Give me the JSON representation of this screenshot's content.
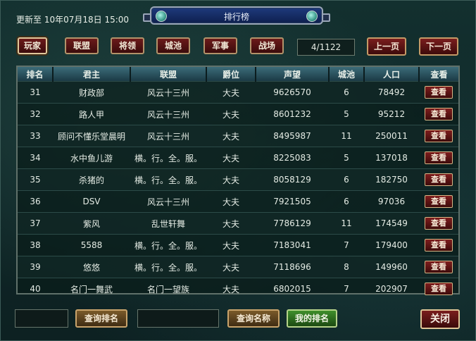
{
  "header": {
    "update_text": "更新至 10年07月18日 15:00",
    "title": "排行榜"
  },
  "tabs": [
    {
      "label": "玩家",
      "active": true
    },
    {
      "label": "联盟",
      "active": false
    },
    {
      "label": "将领",
      "active": false
    },
    {
      "label": "城池",
      "active": false
    },
    {
      "label": "军事",
      "active": false
    },
    {
      "label": "战场",
      "active": false
    }
  ],
  "pagination": {
    "indicator": "4/1122",
    "prev_label": "上一页",
    "next_label": "下一页"
  },
  "table": {
    "columns": [
      "排名",
      "君主",
      "联盟",
      "爵位",
      "声望",
      "城池",
      "人口",
      "查看"
    ],
    "view_label": "查看",
    "rows": [
      {
        "rank": "31",
        "lord": "财政部",
        "alliance": "风云十三州",
        "title": "大夫",
        "prestige": "9626570",
        "cities": "6",
        "population": "78492"
      },
      {
        "rank": "32",
        "lord": "路人甲",
        "alliance": "风云十三州",
        "title": "大夫",
        "prestige": "8601232",
        "cities": "5",
        "population": "95212"
      },
      {
        "rank": "33",
        "lord": "顾问不懂乐堂晨明",
        "alliance": "风云十三州",
        "title": "大夫",
        "prestige": "8495987",
        "cities": "11",
        "population": "250011"
      },
      {
        "rank": "34",
        "lord": "水中鱼儿游",
        "alliance": "横。行。全。服。",
        "title": "大夫",
        "prestige": "8225083",
        "cities": "5",
        "population": "137018"
      },
      {
        "rank": "35",
        "lord": "杀猪的",
        "alliance": "横。行。全。服。",
        "title": "大夫",
        "prestige": "8058129",
        "cities": "6",
        "population": "182750"
      },
      {
        "rank": "36",
        "lord": "DSV",
        "alliance": "风云十三州",
        "title": "大夫",
        "prestige": "7921505",
        "cities": "6",
        "population": "97036"
      },
      {
        "rank": "37",
        "lord": "紫风",
        "alliance": "乱世轩舞",
        "title": "大夫",
        "prestige": "7786129",
        "cities": "11",
        "population": "174549"
      },
      {
        "rank": "38",
        "lord": "5588",
        "alliance": "横。行。全。服。",
        "title": "大夫",
        "prestige": "7183041",
        "cities": "7",
        "population": "179400"
      },
      {
        "rank": "39",
        "lord": "悠悠",
        "alliance": "横。行。全。服。",
        "title": "大夫",
        "prestige": "7118696",
        "cities": "8",
        "population": "149960"
      },
      {
        "rank": "40",
        "lord": "名门一舞武",
        "alliance": "名门一望族",
        "title": "大夫",
        "prestige": "6802015",
        "cities": "7",
        "population": "202907"
      }
    ]
  },
  "footer": {
    "rank_input_value": "",
    "query_rank_label": "查询排名",
    "name_input_value": "",
    "query_name_label": "查询名称",
    "my_rank_label": "我的排名",
    "close_label": "关闭"
  }
}
